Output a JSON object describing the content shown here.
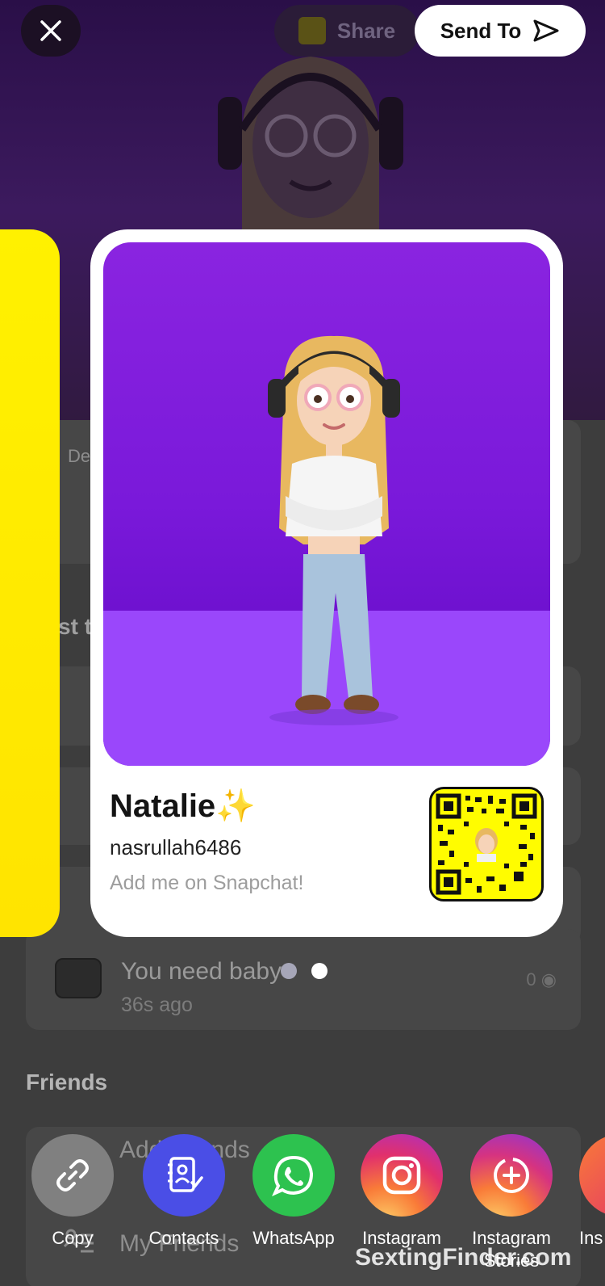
{
  "background": {
    "story_title": "You need baby",
    "story_time": "36s ago",
    "story_views": "0",
    "friends_title": "Friends",
    "friends_item_1": "Add Friends",
    "friends_item_2": "My Friends",
    "frag_1": "De",
    "frag_2": "st t"
  },
  "top_bar": {
    "share_label": "Share",
    "send_label": "Send To"
  },
  "profile_card": {
    "display_name": "Natalie✨",
    "username": "nasrullah6486",
    "tagline": "Add me on Snapchat!"
  },
  "pager": {
    "count": 2,
    "active_index": 1
  },
  "share_options": [
    {
      "label": "Copy",
      "icon": "link-icon",
      "color": "#808080"
    },
    {
      "label": "Contacts",
      "icon": "contacts-icon",
      "color": "#4a4ee6"
    },
    {
      "label": "WhatsApp",
      "icon": "whatsapp-icon",
      "color": "#2dc24f"
    },
    {
      "label": "Instagram",
      "icon": "instagram-icon",
      "color": "#e1306c"
    },
    {
      "label": "Instagram",
      "sublabel": "Stories",
      "icon": "instagram-stories-icon",
      "color": "#c13584"
    },
    {
      "label": "Ins",
      "icon": "instagram-icon",
      "color": "#f57a32"
    }
  ],
  "watermark": "SextingFinder.com",
  "colors": {
    "accent_purple": "#7a19da",
    "snap_yellow": "#fffc00",
    "send_button_bg": "#ffffff"
  }
}
